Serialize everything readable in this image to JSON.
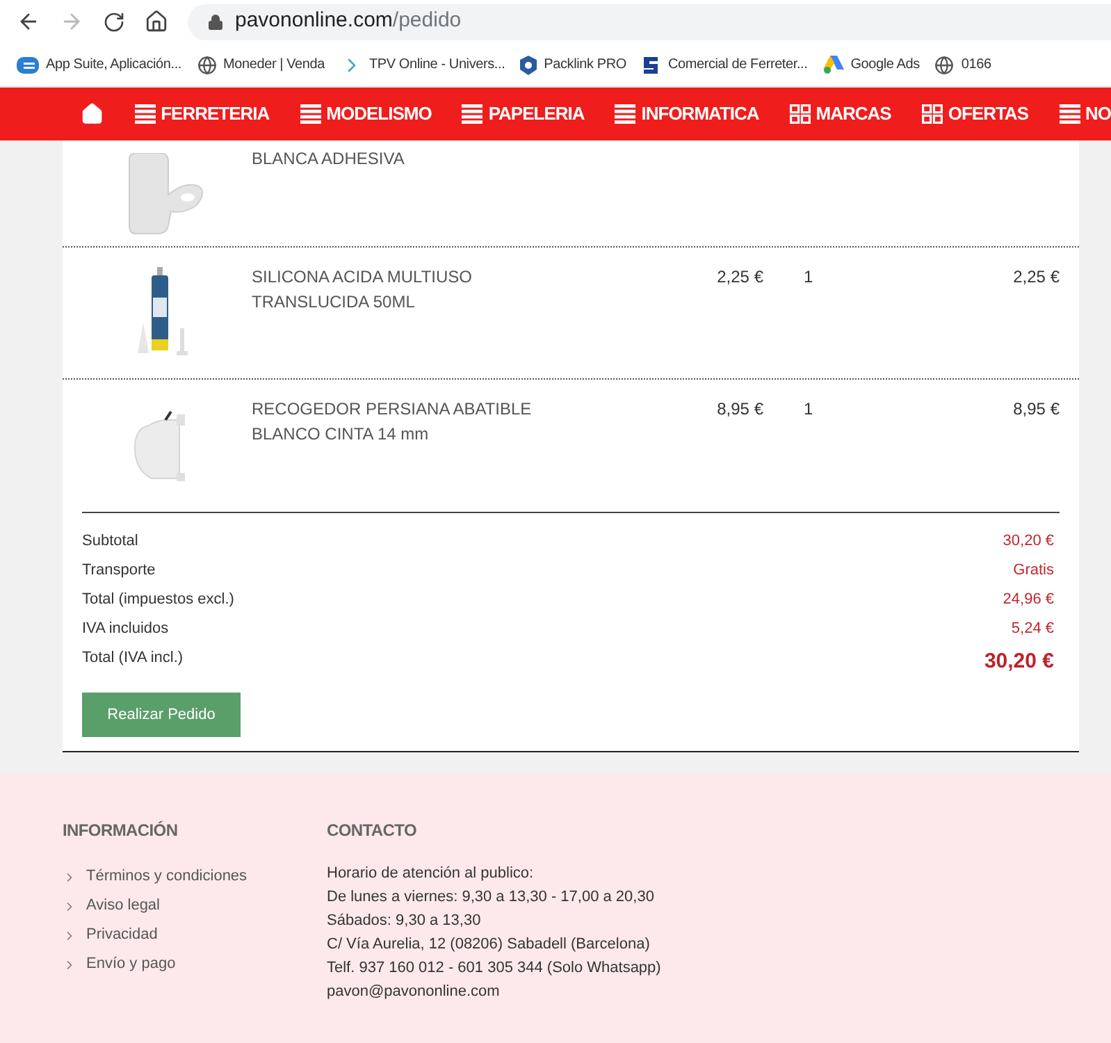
{
  "browser": {
    "forward_disabled": true,
    "url_host": "pavononline.com",
    "url_path": "/pedido",
    "bookmarks": [
      {
        "label": "App Suite, Aplicación...",
        "kind": "suite"
      },
      {
        "label": "Moneder | Venda",
        "kind": "globe"
      },
      {
        "label": "TPV Online - Univers...",
        "kind": "chevron"
      },
      {
        "label": "Packlink PRO",
        "kind": "packlink"
      },
      {
        "label": "Comercial de Ferreter...",
        "kind": "comercial"
      },
      {
        "label": "Google Ads",
        "kind": "ads"
      },
      {
        "label": "0166",
        "kind": "globe"
      }
    ]
  },
  "nav": {
    "items": [
      {
        "label": "FERRETERIA",
        "kind": "list"
      },
      {
        "label": "MODELISMO",
        "kind": "list"
      },
      {
        "label": "PAPELERIA",
        "kind": "list"
      },
      {
        "label": "INFORMATICA",
        "kind": "list"
      },
      {
        "label": "MARCAS",
        "kind": "grid"
      },
      {
        "label": "OFERTAS",
        "kind": "grid"
      },
      {
        "label": "NO",
        "kind": "list"
      }
    ]
  },
  "order": {
    "items": [
      {
        "kind": "hook",
        "name_lines": [
          "BLANCA ADHESIVA"
        ]
      },
      {
        "kind": "tube",
        "name_lines": [
          "SILICONA ACIDA MULTIUSO",
          "TRANSLUCIDA 50ML"
        ],
        "price": "2,25 €",
        "qty": "1",
        "total": "2,25 €"
      },
      {
        "kind": "roller",
        "name_lines": [
          "RECOGEDOR PERSIANA ABATIBLE",
          "BLANCO CINTA 14 mm"
        ],
        "price": "8,95 €",
        "qty": "1",
        "total": "8,95 €"
      }
    ],
    "totals": [
      {
        "label": "Subtotal",
        "value": "30,20 €",
        "kind": "normal"
      },
      {
        "label": "Transporte",
        "value": "Gratis",
        "kind": "normal"
      },
      {
        "label": "Total (impuestos excl.)",
        "value": "24,96 €",
        "kind": "normal"
      },
      {
        "label": "IVA incluidos",
        "value": "5,24 €",
        "kind": "normal"
      },
      {
        "label": "Total (IVA incl.)",
        "value": "30,20 €",
        "kind": "grand"
      }
    ],
    "button": "Realizar Pedido"
  },
  "footer": {
    "info": {
      "title": "INFORMACIÓN",
      "links": [
        "Términos y condiciones",
        "Aviso legal",
        "Privacidad",
        "Envío y pago"
      ]
    },
    "contact": {
      "title": "CONTACTO",
      "lines": [
        "Horario de atención al publico:",
        "De lunes a viernes: 9,30 a 13,30 - 17,00 a 20,30",
        "Sábados: 9,30 a 13,30",
        "C/ Vía Aurelia, 12 (08206) Sabadell (Barcelona)",
        "Telf. 937 160 012 - 601 305 344 (Solo Whatsapp)",
        "pavon@pavononline.com"
      ]
    }
  }
}
